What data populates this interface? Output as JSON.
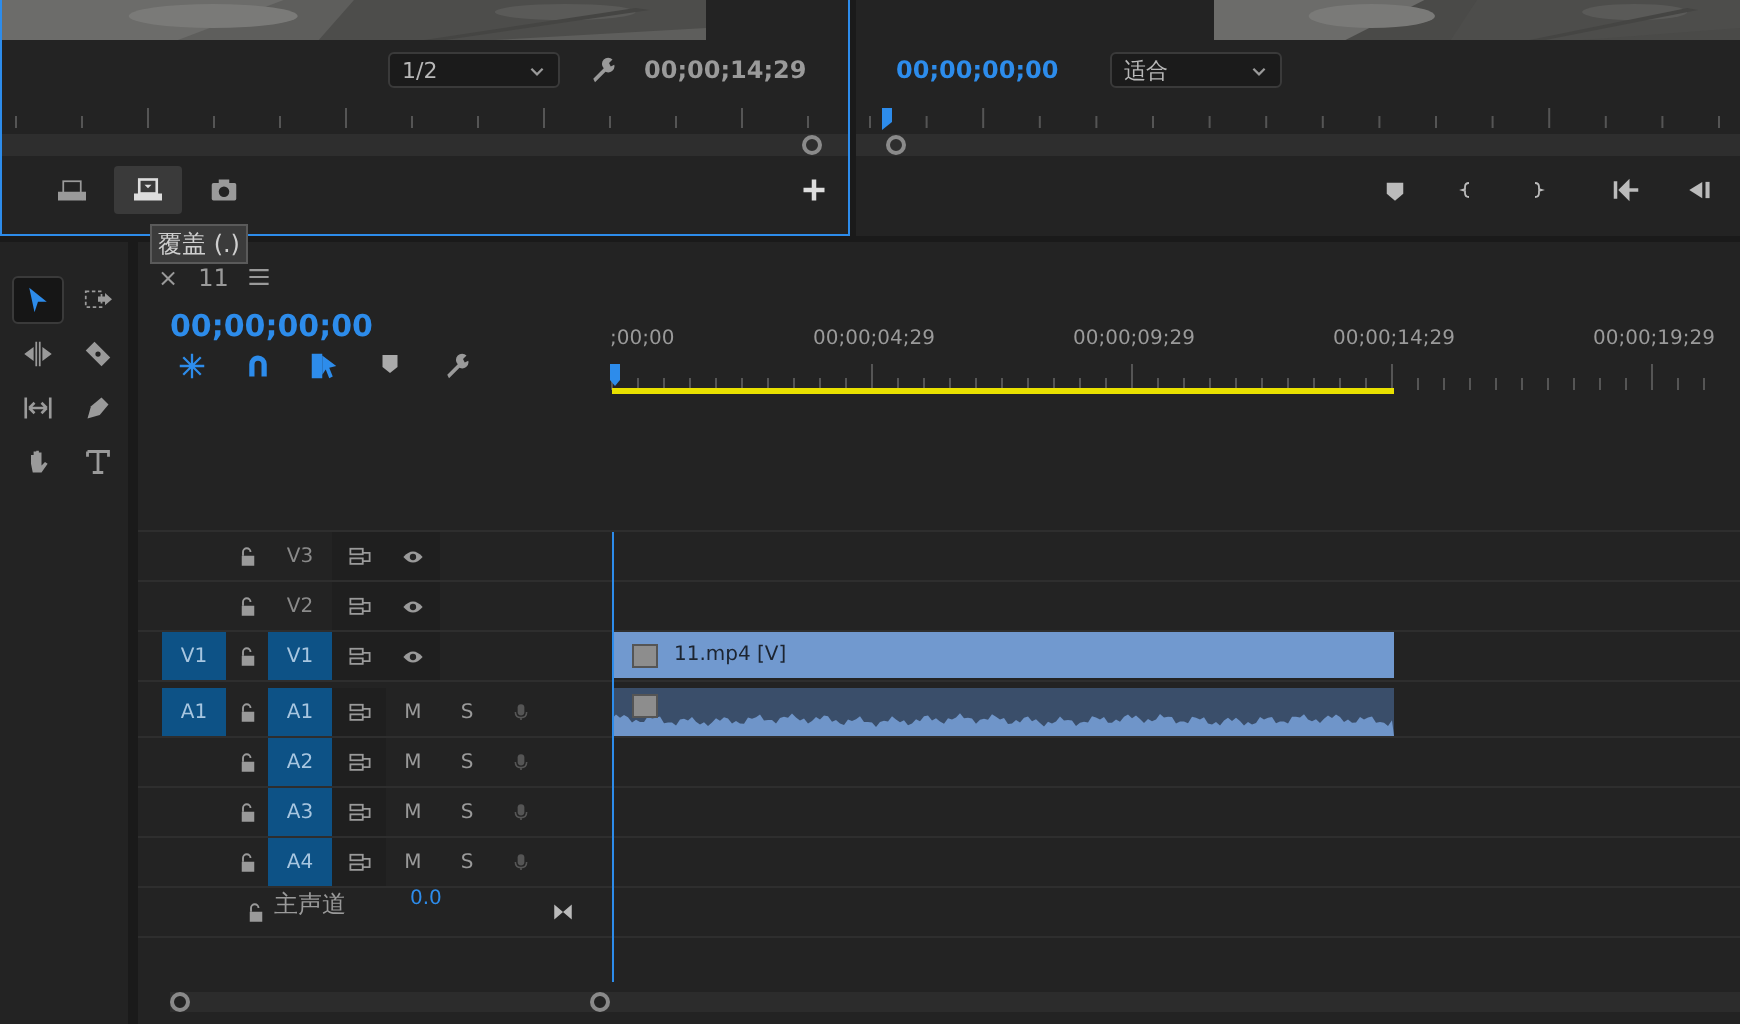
{
  "source_monitor": {
    "focused": true,
    "resolution": "1/2",
    "duration": "00;00;14;29",
    "buttons": [
      {
        "selected": false
      },
      {
        "selected": true
      },
      {
        "selected": false
      }
    ]
  },
  "tooltip": "覆盖 (.)",
  "program_monitor": {
    "timecode": "00;00;00;00",
    "zoom": "适合"
  },
  "tools": [
    {
      "selected": true
    },
    {
      "selected": false
    },
    {
      "selected": false
    },
    {
      "selected": false
    },
    {
      "selected": false
    },
    {
      "selected": false
    },
    {
      "selected": false
    },
    {
      "selected": false
    }
  ],
  "timeline": {
    "tab_close": "×",
    "title": "11",
    "timecode": "00;00;00;00",
    "ruler_labels": [
      ";00;00",
      "00;00;04;29",
      "00;00;09;29",
      "00;00;14;29",
      "00;00;19;29"
    ],
    "tracks": [
      {
        "kind": "video",
        "label": "V3",
        "targeted": false
      },
      {
        "kind": "video",
        "label": "V2",
        "targeted": false
      },
      {
        "kind": "video",
        "source_patch": "V1",
        "label": "V1",
        "targeted": true,
        "clip": {
          "kind": "video",
          "name": "11.mp4 [V]"
        }
      },
      {
        "kind": "audio",
        "source_patch": "A1",
        "label": "A1",
        "targeted": true,
        "mute": "M",
        "solo": "S",
        "clip": {
          "kind": "audio"
        }
      },
      {
        "kind": "audio",
        "label": "A2",
        "targeted": true,
        "mute": "M",
        "solo": "S"
      },
      {
        "kind": "audio",
        "label": "A3",
        "targeted": true,
        "mute": "M",
        "solo": "S"
      },
      {
        "kind": "audio",
        "label": "A4",
        "targeted": true,
        "mute": "M",
        "solo": "S"
      },
      {
        "kind": "master",
        "label": "主声道",
        "volume": "0.0"
      }
    ]
  }
}
